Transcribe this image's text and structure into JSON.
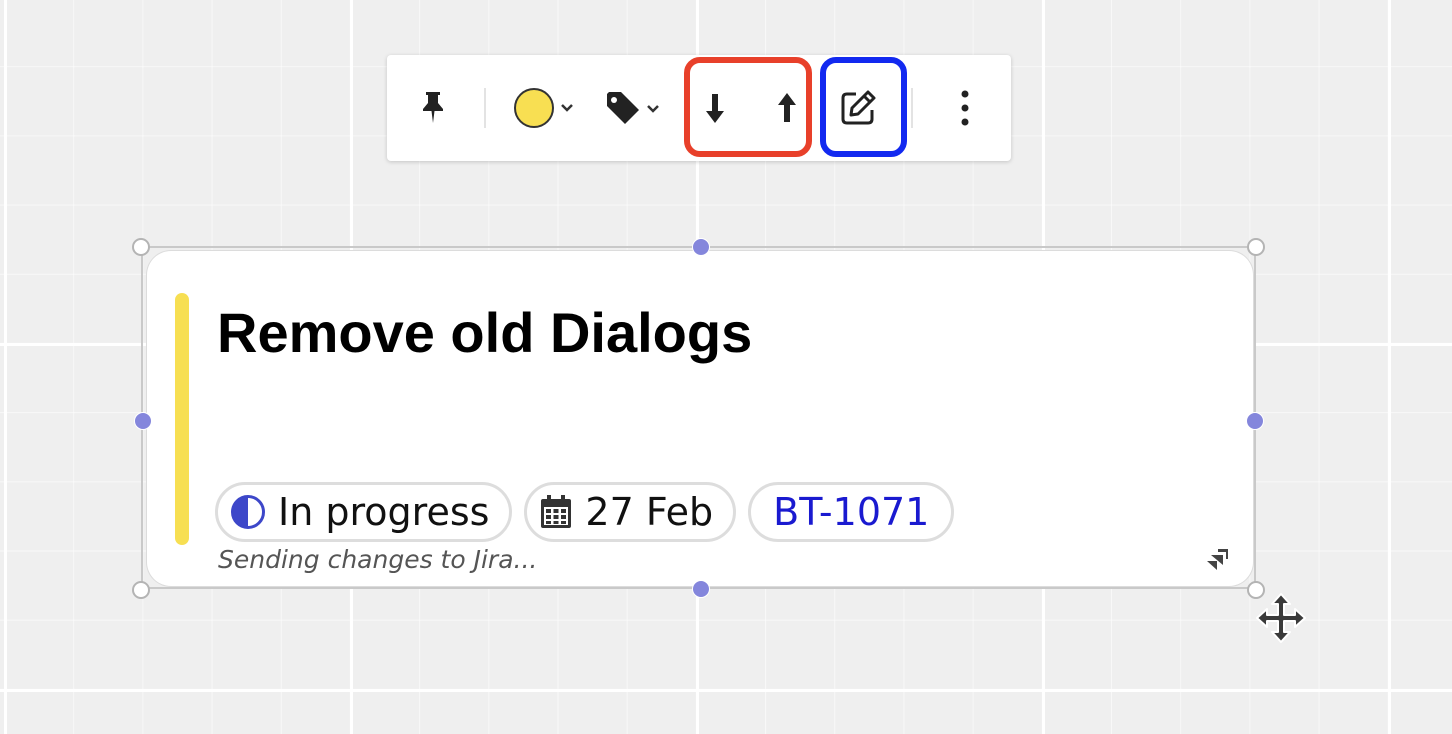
{
  "toolbar": {
    "items": [
      {
        "name": "pin",
        "icon": "pin-icon"
      },
      {
        "name": "color",
        "icon": "color-circle-icon",
        "color": "#f8df52"
      },
      {
        "name": "tag",
        "icon": "tag-icon"
      },
      {
        "name": "send-backward",
        "icon": "arrow-down-icon"
      },
      {
        "name": "bring-forward",
        "icon": "arrow-up-icon"
      },
      {
        "name": "edit",
        "icon": "edit-icon"
      },
      {
        "name": "more",
        "icon": "more-vertical-icon"
      }
    ],
    "highlight_colors": {
      "layer_group": "#e8402a",
      "edit": "#1229f0"
    }
  },
  "card": {
    "title": "Remove old Dialogs",
    "accent_color": "#f7df52",
    "status": {
      "label": "In progress",
      "icon": "half-circle-icon",
      "color": "#3d47c9"
    },
    "due_date": {
      "label": "27 Feb",
      "icon": "calendar-icon"
    },
    "issue_key": {
      "label": "BT-1071",
      "color": "#1a1ad0"
    },
    "sync_status": "Sending changes to Jira...",
    "source_icon": "jira-icon"
  },
  "selection": {
    "handle_color": "#8486dc"
  },
  "cursor": "move-cursor-icon"
}
